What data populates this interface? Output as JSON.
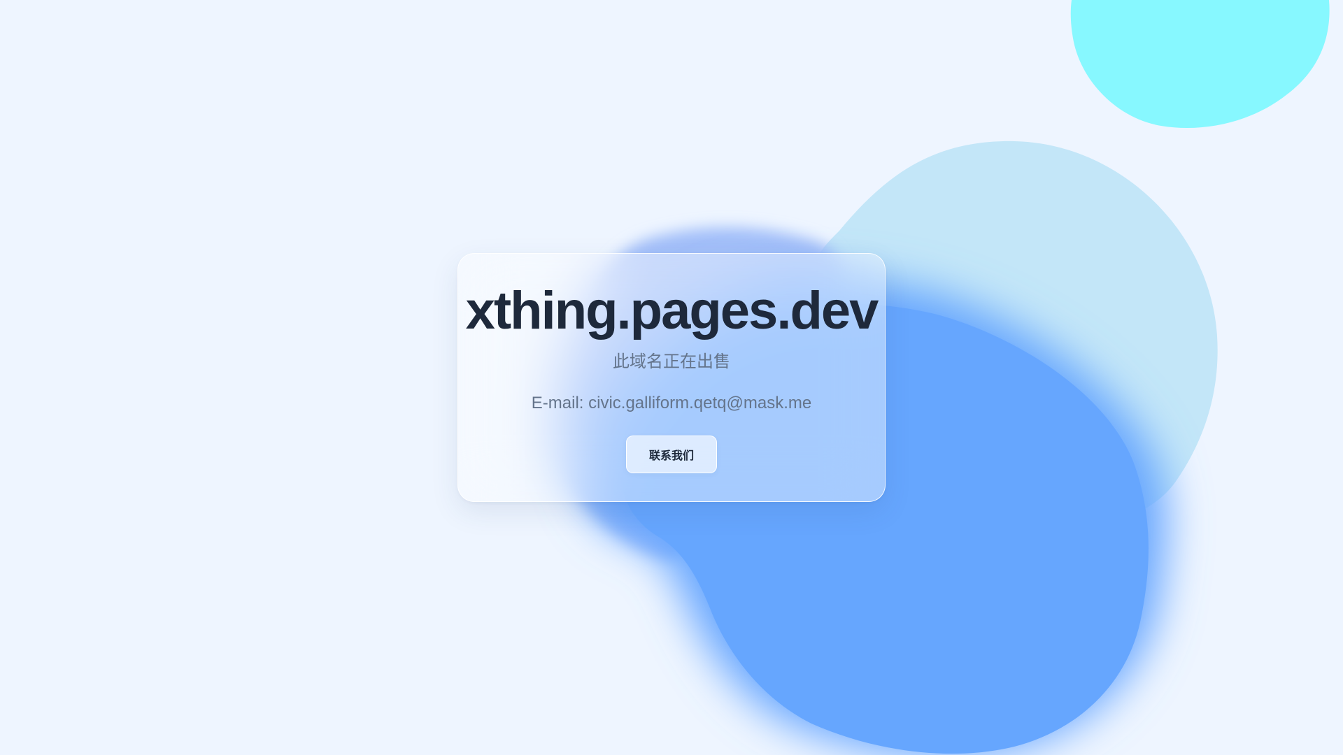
{
  "page": {
    "domain": "xthing.pages.dev",
    "for_sale_text": "此域名正在出售",
    "email_line": "E-mail: civic.galliform.qetq@mask.me",
    "contact_button_label": "联系我们"
  },
  "colors": {
    "background": "#eef5ff",
    "blob_cyan": "#87f8ff",
    "blob_light_blue": "#c3e6f8",
    "blob_blue": "#66a6fe",
    "text_dark": "#1e293b",
    "text_muted": "#64748b"
  }
}
